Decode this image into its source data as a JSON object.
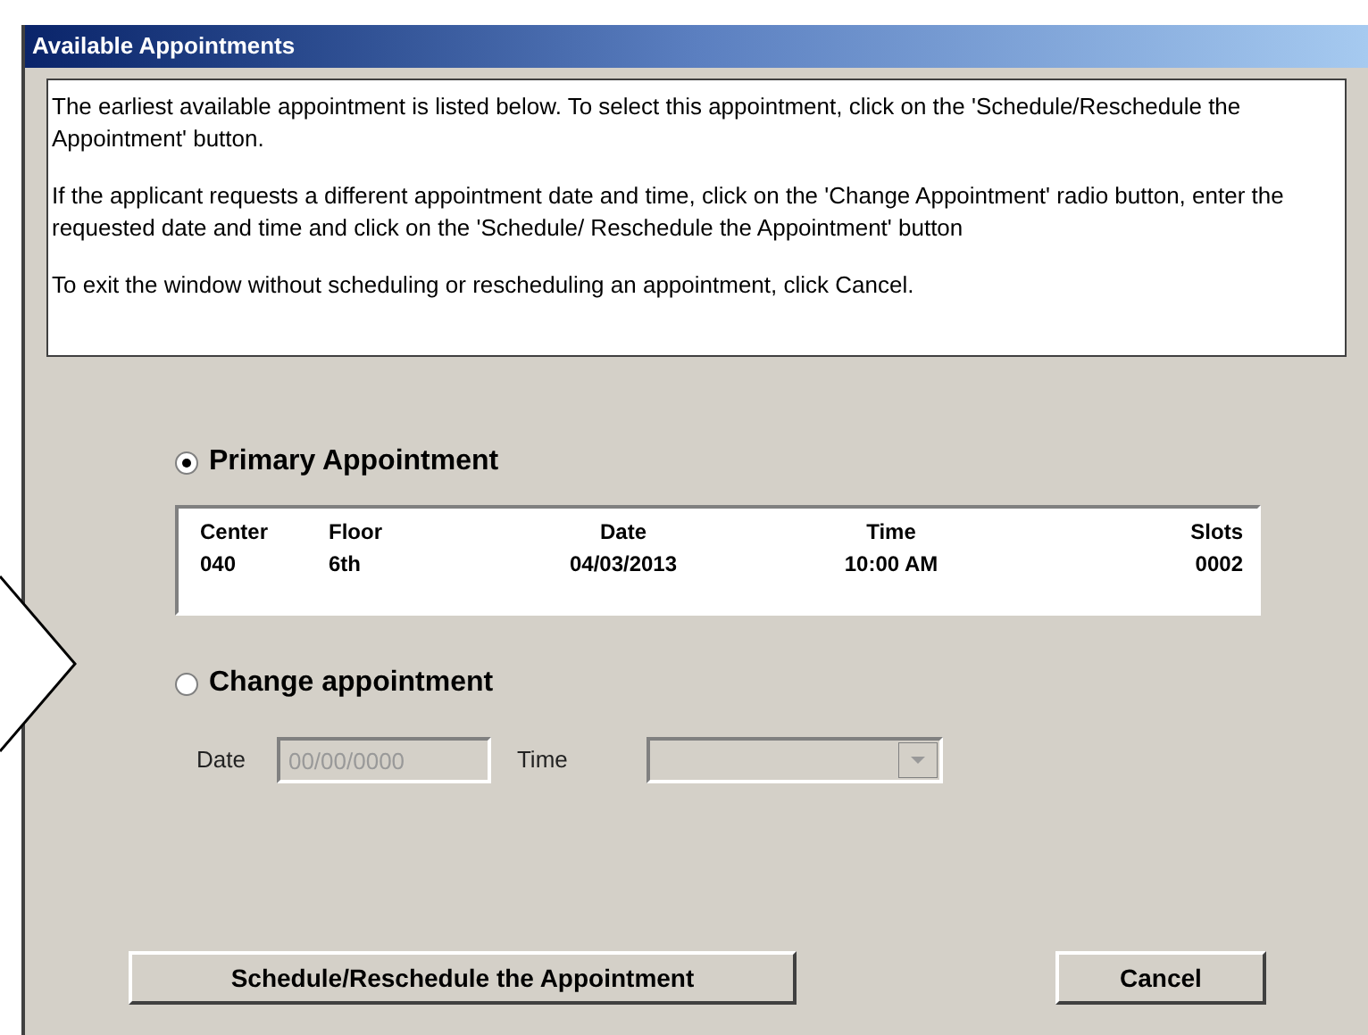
{
  "window": {
    "title": "Available Appointments"
  },
  "instructions": [
    "The earliest available appointment is listed below. To select this appointment, click on the 'Schedule/Reschedule the Appointment' button.",
    "If the applicant requests a different appointment date and time, click on the 'Change Appointment' radio button, enter the requested date and time and click on the 'Schedule/ Reschedule the Appointment' button",
    "To exit the window without scheduling or rescheduling an appointment, click Cancel."
  ],
  "options": [
    {
      "label": "Primary Appointment",
      "selected": true
    },
    {
      "label": "Change appointment",
      "selected": false
    }
  ],
  "table": {
    "columns": [
      "Center",
      "Floor",
      "Date",
      "Time",
      "Slots"
    ],
    "rows": [
      [
        "040",
        "6th",
        "04/03/2013",
        "10:00 AM",
        "0002"
      ]
    ]
  },
  "change_fields": {
    "date_label": "Date",
    "date_value": "00/00/0000",
    "date_disabled": true,
    "time_label": "Time",
    "time_disabled": true
  },
  "buttons": [
    "Schedule/Reschedule the Appointment",
    "Cancel"
  ]
}
